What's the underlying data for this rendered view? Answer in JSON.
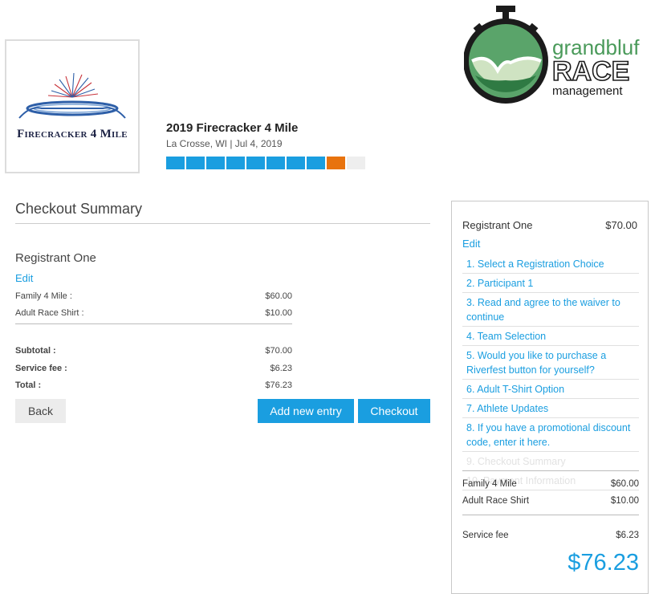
{
  "event": {
    "logo_text": "Firecracker 4 Mile",
    "title": "2019 Firecracker 4 Mile",
    "subtitle": "La Crosse, WI | Jul 4, 2019",
    "progress": {
      "total_steps": 10,
      "completed_steps": 8,
      "current_step": 9
    }
  },
  "brand": {
    "line1": "grandbluf",
    "line2": "RACE",
    "line3": "management"
  },
  "checkout": {
    "title": "Checkout Summary",
    "registrant": "Registrant One",
    "edit_label": "Edit",
    "items": [
      {
        "label": "Family 4 Mile :",
        "amount": "$60.00"
      },
      {
        "label": "Adult Race Shirt :",
        "amount": "$10.00"
      }
    ],
    "subtotal_label": "Subtotal :",
    "subtotal": "$70.00",
    "fee_label": "Service fee :",
    "fee": "$6.23",
    "total_label": "Total :",
    "total": "$76.23",
    "back_label": "Back",
    "add_label": "Add new entry",
    "checkout_label": "Checkout"
  },
  "sidebar": {
    "registrant": "Registrant One",
    "price": "$70.00",
    "edit_label": "Edit",
    "steps": [
      {
        "label": "1. Select a Registration Choice",
        "enabled": true
      },
      {
        "label": "2. Participant 1",
        "enabled": true
      },
      {
        "label": "3. Read and agree to the waiver to continue",
        "enabled": true
      },
      {
        "label": "4. Team Selection",
        "enabled": true
      },
      {
        "label": "5. Would you like to purchase a Riverfest button for yourself?",
        "enabled": true
      },
      {
        "label": "6. Adult T-Shirt Option",
        "enabled": true
      },
      {
        "label": "7. Athlete Updates",
        "enabled": true
      },
      {
        "label": "8. If you have a promotional discount code, enter it here.",
        "enabled": true
      },
      {
        "label": "9. Checkout Summary",
        "enabled": false
      },
      {
        "label": "10. Payment Information",
        "enabled": false
      }
    ],
    "items": [
      {
        "label": "Family 4 Mile",
        "amount": "$60.00"
      },
      {
        "label": "Adult Race Shirt",
        "amount": "$10.00"
      }
    ],
    "fee_label": "Service fee",
    "fee": "$6.23",
    "total": "$76.23"
  },
  "colors": {
    "accent": "#1a9ee0",
    "progress_current": "#e8730e",
    "brand_green": "#4a9a5a",
    "brand_dark": "#1b1b1b"
  }
}
